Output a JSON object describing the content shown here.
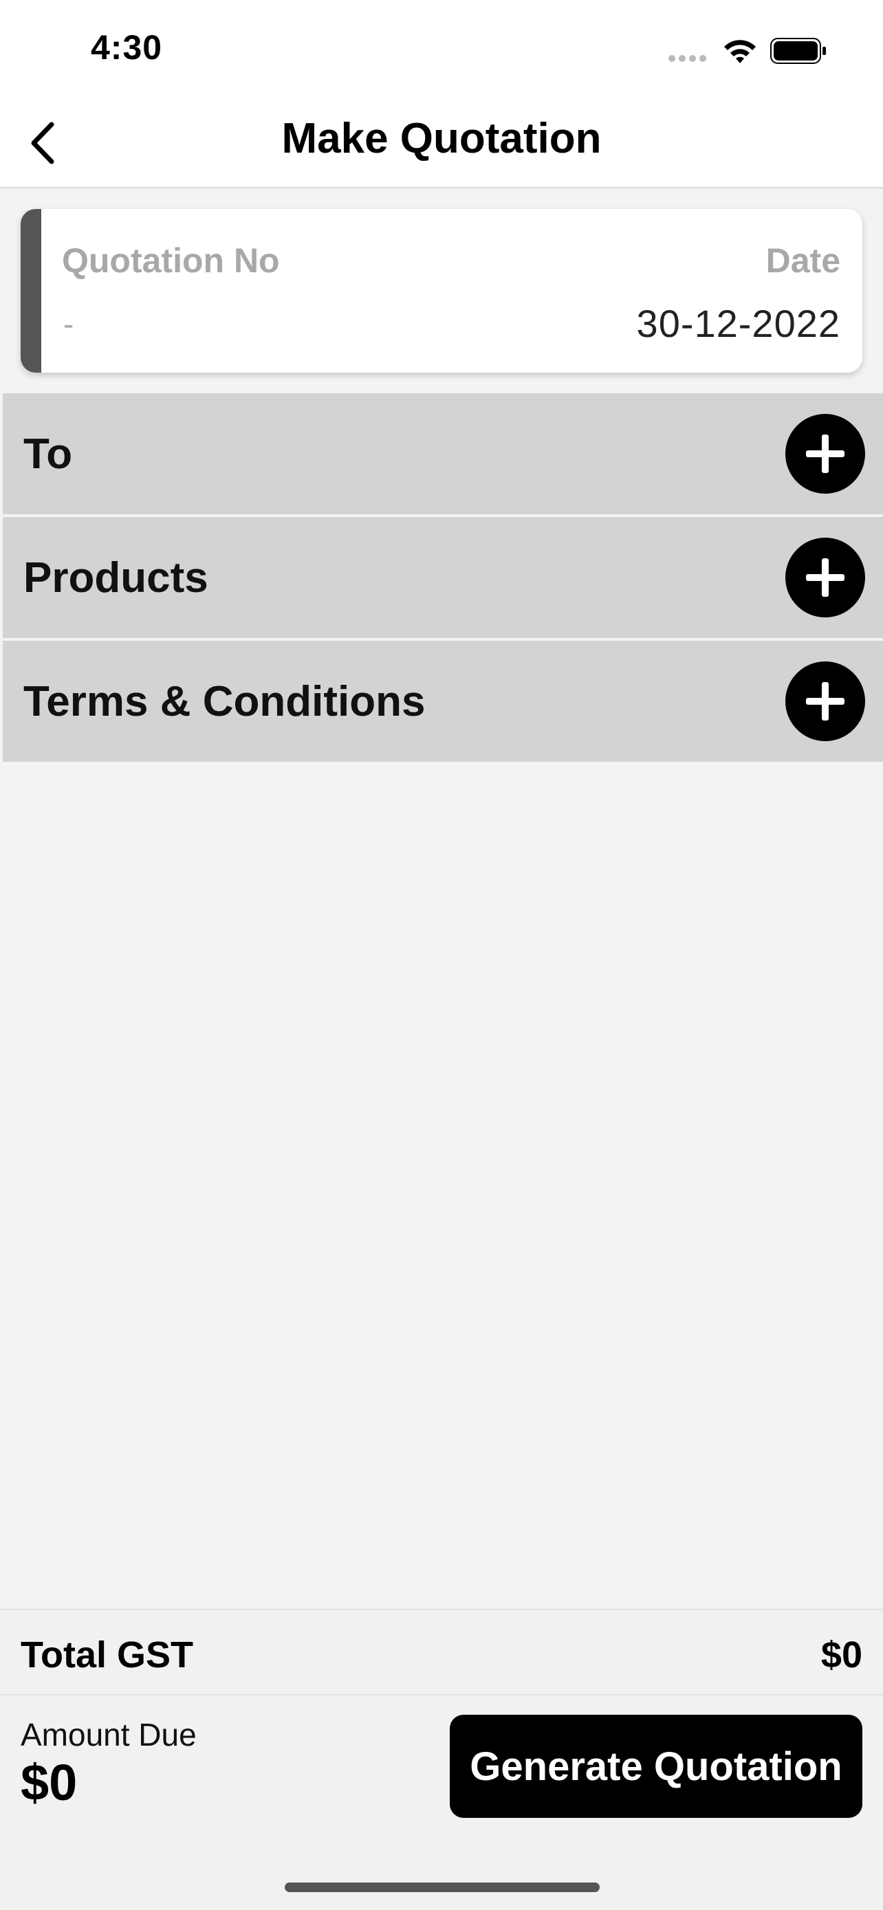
{
  "status_bar": {
    "time": "4:30"
  },
  "header": {
    "title": "Make Quotation",
    "back_icon": "chevron-left-icon"
  },
  "quotation_card": {
    "number_label": "Quotation No",
    "number_value": "-",
    "date_label": "Date",
    "date_value": "30-12-2022"
  },
  "sections": [
    {
      "label": "To",
      "icon": "plus-icon"
    },
    {
      "label": "Products",
      "icon": "plus-icon"
    },
    {
      "label": "Terms & Conditions",
      "icon": "plus-icon"
    }
  ],
  "summary": {
    "gst_label": "Total GST",
    "gst_value": "$0",
    "amount_due_label": "Amount Due",
    "amount_due_value": "$0"
  },
  "actions": {
    "generate_label": "Generate Quotation"
  },
  "colors": {
    "accent_bar": "#555555",
    "section_bg": "#d3d3d3",
    "button_bg": "#000000"
  }
}
